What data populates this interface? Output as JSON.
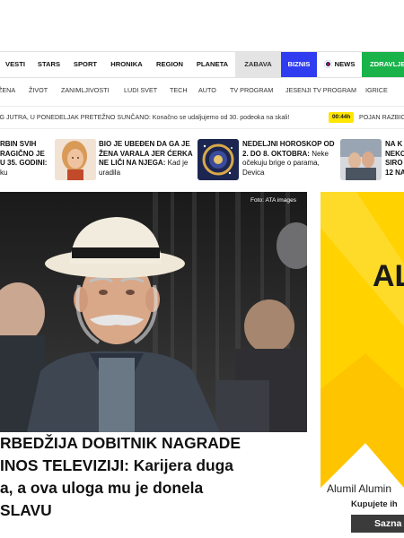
{
  "main_nav": [
    {
      "label": "VESTI"
    },
    {
      "label": "STARS"
    },
    {
      "label": "SPORT"
    },
    {
      "label": "HRONIKA"
    },
    {
      "label": "REGION"
    },
    {
      "label": "PLANETA"
    },
    {
      "label": "ZABAVA"
    },
    {
      "label": "BIZNIS"
    },
    {
      "label": "NEWS"
    },
    {
      "label": "ZDRAVLJE"
    }
  ],
  "sub_nav": [
    {
      "label": "ŽENA"
    },
    {
      "label": "ŽIVOT"
    },
    {
      "label": "ZANIMLJIVOSTI"
    },
    {
      "label": "LUDI SVET"
    },
    {
      "label": "TECH"
    },
    {
      "label": "AUTO"
    },
    {
      "label": "TV PROGRAM"
    },
    {
      "label": "JESENJI TV PROGRAM"
    },
    {
      "label": "IGRICE"
    }
  ],
  "ticker": {
    "text": "OG JUTRA, U PONEDELJAK PRETEŽNO SUNČANO: Konačno se udaljujemo od 30. podeoka na skali!",
    "time": "00:44h",
    "next_text": "POJAN RAZBIO"
  },
  "strip": [
    {
      "bold": "RBIN SVIH RAGIČNO JE U 35. GODINI:",
      "plain": "ku"
    },
    {
      "bold": "BIO JE UBEĐEN DA GA JE ŽENA VARALA JER ĆERKA NE LIČI NA NJEGA:",
      "plain": "Kad je uradila"
    },
    {
      "bold": "NEDELJNI HOROSKOP OD 2. DO 8. OKTOBRA:",
      "plain": "Neke očekuju brige o parama, Devica"
    },
    {
      "bold": "NA K NEKO SIRO 12 NA",
      "plain": ""
    }
  ],
  "hero": {
    "credit": "Foto: ATA images",
    "headline_lines": [
      "RBEDŽIJA DOBITNIK NAGRADE",
      "INOS TELEVIZIJI: Karijera duga",
      "a, a ova uloga mu je donela",
      "SLAVU"
    ]
  },
  "ad": {
    "logo_text": "AL",
    "brand": "Alumil Alumin",
    "cta_text": "Kupujete ih",
    "button": "Sazna",
    "colors": {
      "accent": "#ffd200",
      "dark": "#3b3b3b"
    }
  },
  "colors": {
    "biznis": "#2f3cf0",
    "zdravlje": "#19b34a",
    "zabava": "#e4e4e4",
    "time_badge": "#ffe600"
  }
}
